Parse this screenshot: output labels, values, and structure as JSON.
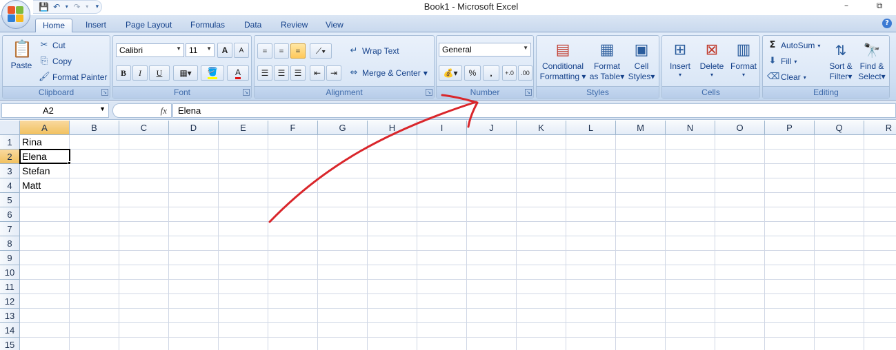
{
  "window": {
    "title": "Book1 - Microsoft Excel",
    "minimize": "–",
    "restore": "⧉"
  },
  "qat": {
    "save": "💾",
    "undo": "↶",
    "undo_drop": "▾",
    "redo": "↷",
    "redo_drop": "▾",
    "customize": "▾"
  },
  "tabs": [
    "Home",
    "Insert",
    "Page Layout",
    "Formulas",
    "Data",
    "Review",
    "View"
  ],
  "help": "?",
  "clipboard": {
    "label": "Clipboard",
    "paste": "Paste",
    "cut": "Cut",
    "copy": "Copy",
    "format_painter": "Format Painter"
  },
  "font": {
    "label": "Font",
    "name": "Calibri",
    "size": "11",
    "grow": "A",
    "shrink": "A",
    "bold": "B",
    "italic": "I",
    "underline": "U",
    "font_color": "A"
  },
  "alignment": {
    "label": "Alignment",
    "wrap_text": "Wrap Text",
    "merge_center": "Merge & Center"
  },
  "number": {
    "label": "Number",
    "format": "General",
    "percent": "%",
    "comma": ",",
    "inc_decimal": "+.0",
    "dec_decimal": ".00"
  },
  "styles": {
    "label": "Styles",
    "conditional_1": "Conditional",
    "conditional_2": "Formatting",
    "format_table_1": "Format",
    "format_table_2": "as Table",
    "cell_styles_1": "Cell",
    "cell_styles_2": "Styles"
  },
  "cells_group": {
    "label": "Cells",
    "insert": "Insert",
    "delete": "Delete",
    "format": "Format"
  },
  "editing": {
    "label": "Editing",
    "autosum": "AutoSum",
    "fill": "Fill",
    "clear": "Clear",
    "sort_1": "Sort &",
    "sort_2": "Filter",
    "find_1": "Find &",
    "find_2": "Select"
  },
  "formula_bar": {
    "name_box": "A2",
    "fx": "fx",
    "value": "Elena"
  },
  "columns": [
    "A",
    "B",
    "C",
    "D",
    "E",
    "F",
    "G",
    "H",
    "I",
    "J",
    "K",
    "L",
    "M",
    "N",
    "O",
    "P",
    "Q",
    "R"
  ],
  "rows": [
    "1",
    "2",
    "3",
    "4",
    "5",
    "6",
    "7",
    "8",
    "9",
    "10",
    "11",
    "12",
    "13",
    "14",
    "15"
  ],
  "cells": [
    "Rina",
    "Elena",
    "Stefan",
    "Matt"
  ],
  "colors": {
    "accent": "#15428b",
    "annotation_arrow": "#d9262b",
    "selection": "#f1c15f"
  }
}
